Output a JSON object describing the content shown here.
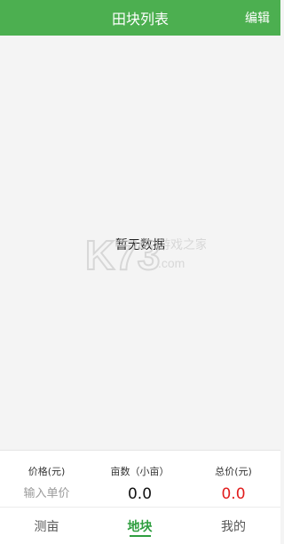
{
  "header": {
    "title": "田块列表",
    "edit_label": "编辑"
  },
  "content": {
    "empty_text": "暂无数据"
  },
  "watermark": {
    "logo_text": "K73",
    "tagline": "游戏之家",
    "domain": ".com"
  },
  "summary": {
    "price_label": "价格(元)",
    "price_placeholder": "输入单价",
    "area_label": "亩数（小亩）",
    "area_value": "0.0",
    "total_label": "总价(元)",
    "total_value": "0.0"
  },
  "tabs": [
    {
      "label": "测亩",
      "active": false
    },
    {
      "label": "地块",
      "active": true
    },
    {
      "label": "我的",
      "active": false
    }
  ],
  "colors": {
    "header_bg": "#4caf50",
    "active_tab": "#2e9e3f",
    "total_value": "#e11c1c"
  }
}
